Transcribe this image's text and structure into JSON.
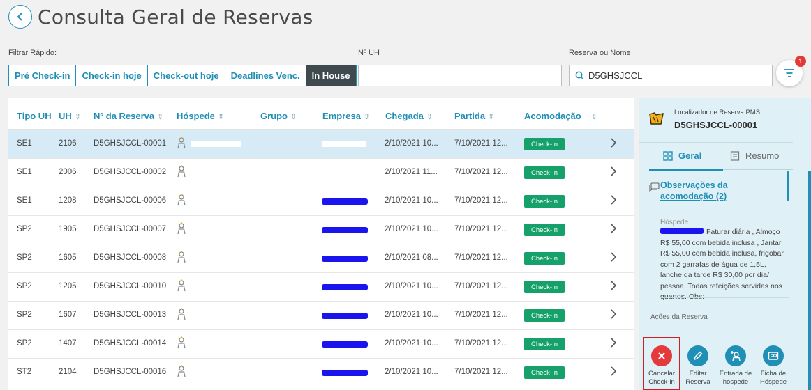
{
  "page": {
    "title": "Consulta Geral de Reservas"
  },
  "filters": {
    "quick_label": "Filtrar Rápido:",
    "quick": [
      {
        "label": "Pré Check-in",
        "active": false
      },
      {
        "label": "Check-in hoje",
        "active": false
      },
      {
        "label": "Check-out hoje",
        "active": false
      },
      {
        "label": "Deadlines Venc.",
        "active": false
      },
      {
        "label": "In House",
        "active": true
      }
    ],
    "uh_label": "Nº UH",
    "uh_value": "",
    "reserva_label": "Reserva ou Nome",
    "reserva_value": "D5GHSJCCL",
    "badge_count": "1"
  },
  "table": {
    "columns": [
      "Tipo UH",
      "UH",
      "Nº da Reserva",
      "Hóspede",
      "Grupo",
      "Empresa",
      "Chegada",
      "Partida",
      "Acomodação"
    ],
    "rows": [
      {
        "tipo": "SE1",
        "uh": "2106",
        "reserva": "D5GHSJCCL-00001",
        "chegada": "2/10/2021 10...",
        "partida": "7/10/2021 12...",
        "acomodacao": "Check-In",
        "selected": true
      },
      {
        "tipo": "SE1",
        "uh": "2006",
        "reserva": "D5GHSJCCL-00002",
        "chegada": "2/10/2021 11...",
        "partida": "7/10/2021 12...",
        "acomodacao": "Check-In",
        "selected": false
      },
      {
        "tipo": "SE1",
        "uh": "1208",
        "reserva": "D5GHSJCCL-00006",
        "chegada": "2/10/2021 10...",
        "partida": "7/10/2021 12...",
        "acomodacao": "Check-In",
        "selected": false
      },
      {
        "tipo": "SP2",
        "uh": "1905",
        "reserva": "D5GHSJCCL-00007",
        "chegada": "2/10/2021 10...",
        "partida": "7/10/2021 12...",
        "acomodacao": "Check-In",
        "selected": false
      },
      {
        "tipo": "SP2",
        "uh": "1605",
        "reserva": "D5GHSJCCL-00008",
        "chegada": "2/10/2021 08...",
        "partida": "7/10/2021 12...",
        "acomodacao": "Check-In",
        "selected": false
      },
      {
        "tipo": "SP2",
        "uh": "1205",
        "reserva": "D5GHSJCCL-00010",
        "chegada": "2/10/2021 10...",
        "partida": "7/10/2021 12...",
        "acomodacao": "Check-In",
        "selected": false
      },
      {
        "tipo": "SP2",
        "uh": "1607",
        "reserva": "D5GHSJCCL-00013",
        "chegada": "2/10/2021 10...",
        "partida": "7/10/2021 12...",
        "acomodacao": "Check-In",
        "selected": false
      },
      {
        "tipo": "SP2",
        "uh": "1407",
        "reserva": "D5GHSJCCL-00014",
        "chegada": "2/10/2021 10...",
        "partida": "7/10/2021 12...",
        "acomodacao": "Check-In",
        "selected": false
      },
      {
        "tipo": "ST2",
        "uh": "2104",
        "reserva": "D5GHSJCCL-00016",
        "chegada": "2/10/2021 10...",
        "partida": "7/10/2021 12...",
        "acomodacao": "Check-In",
        "selected": false
      }
    ]
  },
  "side": {
    "loc_label": "Localizador de Reserva PMS",
    "loc_value": "D5GHSJCCL-00001",
    "tab_geral": "Geral",
    "tab_resumo": "Resumo",
    "obs_link": "Observações da acomodação (2)",
    "hosp_label": "Hóspede",
    "hosp_text": "Faturar diária , Almoço R$ 55,00 com bebida inclusa , Jantar R$ 55,00 com bebida inclusa, frigobar com 2 garrafas de água de 1,5L, lanche da tarde R$ 30,00 por dia/ pessoa. Todas refeições servidas nos quartos. Obs:",
    "acoes_label": "Ações da Reserva",
    "actions": [
      {
        "l1": "Cancelar",
        "l2": "Check-in"
      },
      {
        "l1": "Editar",
        "l2": "Reserva"
      },
      {
        "l1": "Entrada de",
        "l2": "hóspede"
      },
      {
        "l1": "Ficha de",
        "l2": "Hóspede"
      }
    ]
  },
  "colors": {
    "accent": "#1f8fb6",
    "success": "#16a06a",
    "danger": "#e33b3b",
    "active_filter": "#3f4a4f",
    "side_bg": "#dff0f6"
  },
  "icons": [
    "back-arrow-icon",
    "search-icon",
    "filter-icon",
    "guest-icon",
    "chevron-right-icon",
    "folder-icon",
    "grid-icon",
    "document-icon",
    "comment-icon",
    "close-icon",
    "pencil-icon",
    "add-user-icon",
    "id-card-icon"
  ]
}
